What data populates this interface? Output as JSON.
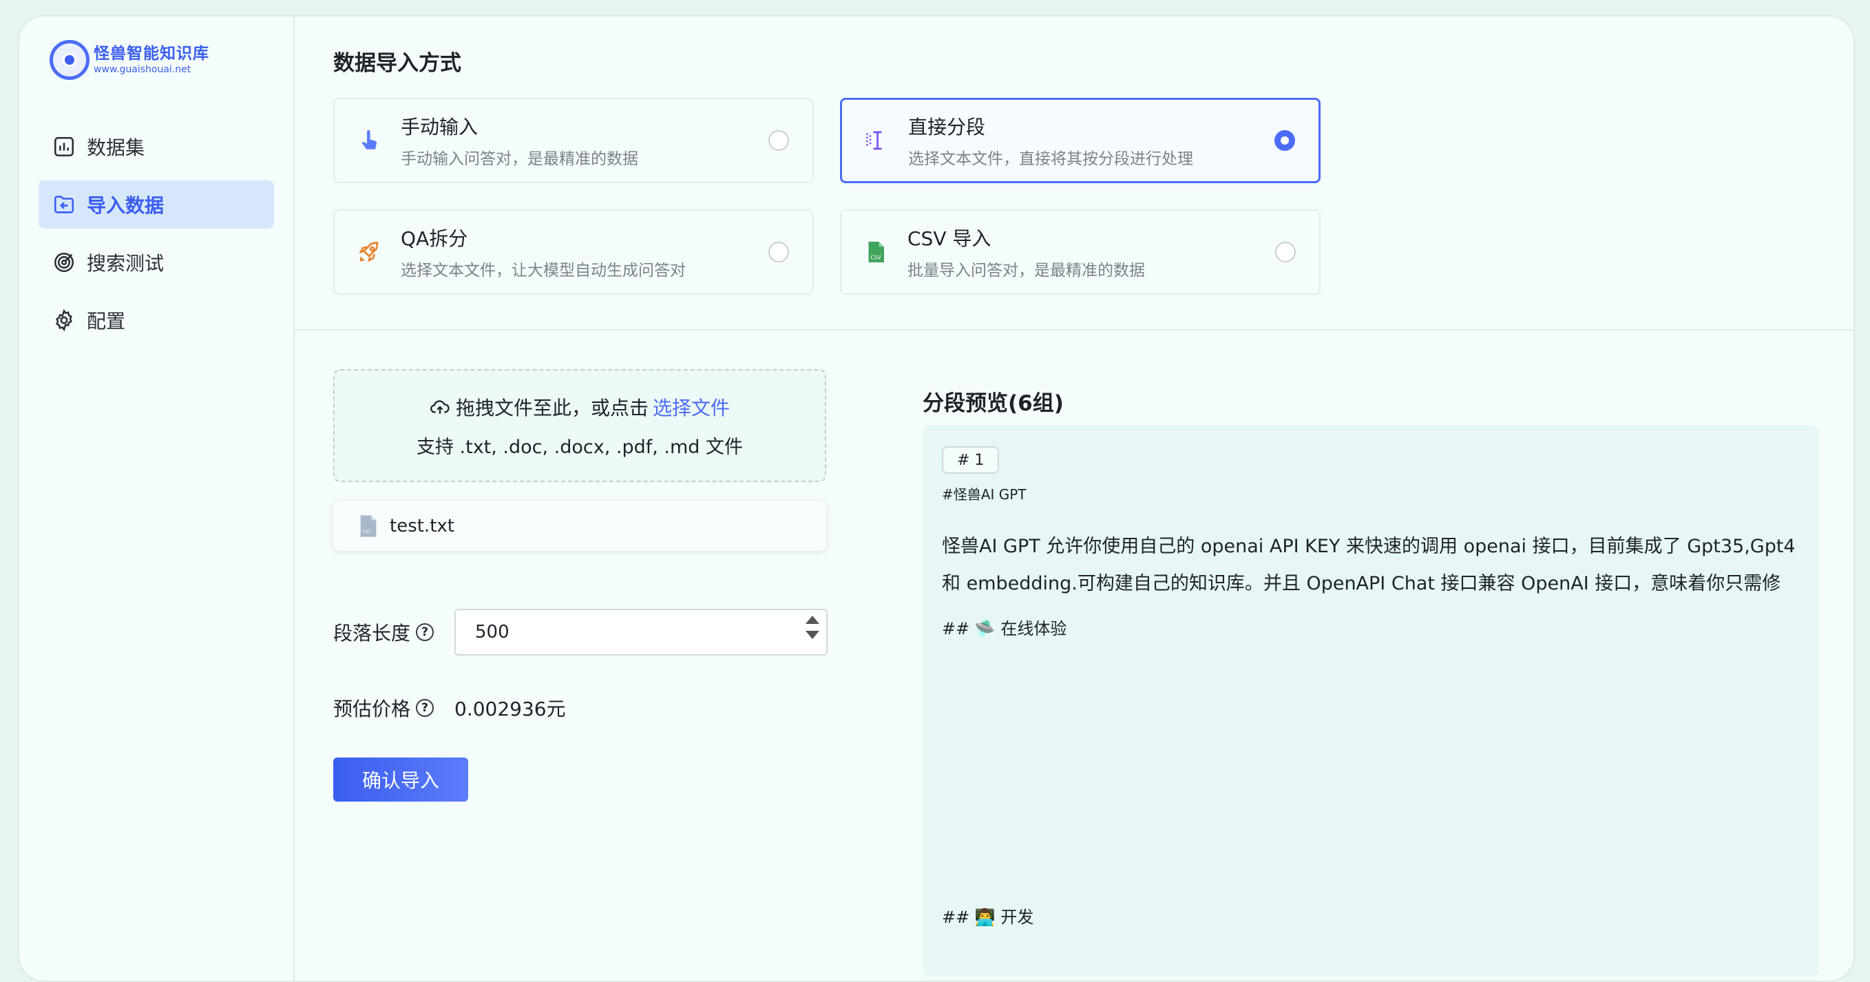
{
  "sidebar": {
    "logo": {
      "title": "怪兽智能知识库",
      "url": "www.guaishouai.net"
    },
    "items": [
      {
        "label": "数据集",
        "icon": "bar-chart-icon",
        "active": false
      },
      {
        "label": "导入数据",
        "icon": "folder-import-icon",
        "active": true
      },
      {
        "label": "搜索测试",
        "icon": "target-icon",
        "active": false
      },
      {
        "label": "配置",
        "icon": "gear-icon",
        "active": false
      }
    ]
  },
  "import": {
    "section_title": "数据导入方式",
    "methods": [
      {
        "title": "手动输入",
        "desc": "手动输入问答对，是最精准的数据",
        "icon": "hand-pointer-icon",
        "selected": false
      },
      {
        "title": "直接分段",
        "desc": "选择文本文件，直接将其按分段进行处理",
        "icon": "text-cursor-icon",
        "selected": true
      },
      {
        "title": "QA拆分",
        "desc": "选择文本文件，让大模型自动生成问答对",
        "icon": "rocket-icon",
        "selected": false
      },
      {
        "title": "CSV 导入",
        "desc": "批量导入问答对，是最精准的数据",
        "icon": "csv-file-icon",
        "selected": false
      }
    ]
  },
  "upload": {
    "prompt": "拖拽文件至此，或点击",
    "link": "选择文件",
    "support": "支持 .txt, .doc, .docx, .pdf, .md 文件",
    "file_name": "test.txt"
  },
  "settings": {
    "chunk_label": "段落长度",
    "chunk_value": "500",
    "price_label": "预估价格",
    "price_value": "0.002936元",
    "confirm_label": "确认导入"
  },
  "preview": {
    "title": "分段预览(6组)",
    "chunk_tag": "# 1",
    "heading": "#怪兽AI  GPT",
    "body_line1": "怪兽AI GPT 允许你使用自己的 openai API KEY 来快速的调用 openai 接口，目前集成了 Gpt35,Gpt4",
    "body_line2": "和 embedding.可构建自己的知识库。并且 OpenAPI Chat 接口兼容 OpenAI 接口，意味着你只需修",
    "sub1": "## 🛸 在线体验",
    "sub2": "## 👨‍💻 开发"
  },
  "colors": {
    "accent": "#4b6cf6",
    "background": "#f4fdfc"
  }
}
